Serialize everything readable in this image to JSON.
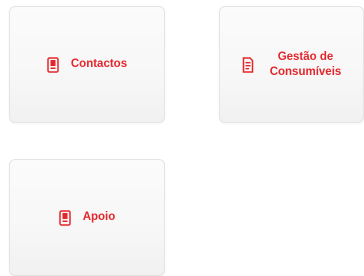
{
  "tiles": {
    "contactos": {
      "label": "Contactos",
      "icon": "phone-document-icon"
    },
    "consumiveis": {
      "label_line1": "Gestão de",
      "label_line2": "Consumíveis",
      "icon": "document-list-icon"
    },
    "apoio": {
      "label": "Apoio",
      "icon": "phone-document-icon"
    }
  },
  "colors": {
    "accent": "#e3262b",
    "tile_border": "#e4e4e4",
    "tile_background": "#f7f7f7"
  }
}
